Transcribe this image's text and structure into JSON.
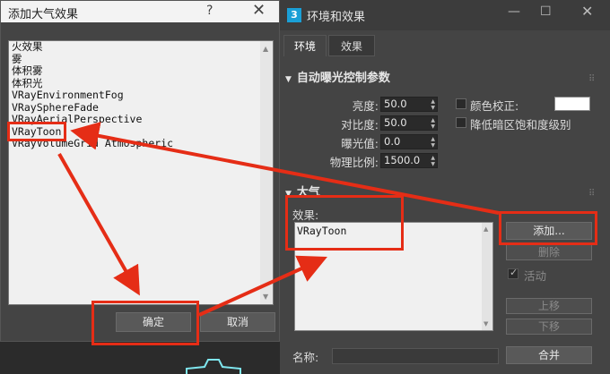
{
  "left_dialog": {
    "title": "添加大气效果",
    "help": "?",
    "close": "✕",
    "effects": [
      "火效果",
      "雾",
      "体积雾",
      "体积光",
      "VRayEnvironmentFog",
      "VRaySphereFade",
      "VRayAerialPerspective",
      "VRayToon",
      "VRayVolumeGrid Atmospheric"
    ],
    "ok_label": "确定",
    "cancel_label": "取消"
  },
  "right_dialog": {
    "title": "环境和效果",
    "logo": "3",
    "minimize": "—",
    "maximize": "☐",
    "close": "✕",
    "tabs": [
      "环境",
      "效果"
    ],
    "exposure_rollout": {
      "title": "自动曝光控制参数",
      "brightness_label": "亮度:",
      "brightness_value": "50.0",
      "contrast_label": "对比度:",
      "contrast_value": "50.0",
      "exposure_label": "曝光值:",
      "exposure_value": "0.0",
      "physical_label": "物理比例:",
      "physical_value": "1500.0",
      "color_correct_label": "颜色校正:",
      "desaturate_label": "降低暗区饱和度级别",
      "swatch_color": "#ffffff"
    },
    "atmosphere_rollout": {
      "title": "大气",
      "effects_label": "效果:",
      "items": [
        "VRayToon"
      ],
      "add_label": "添加...",
      "delete_label": "删除",
      "active_label": "活动",
      "move_up_label": "上移",
      "move_down_label": "下移",
      "name_label": "名称:",
      "merge_label": "合并"
    }
  },
  "colors": {
    "highlight": "#e52d16"
  }
}
